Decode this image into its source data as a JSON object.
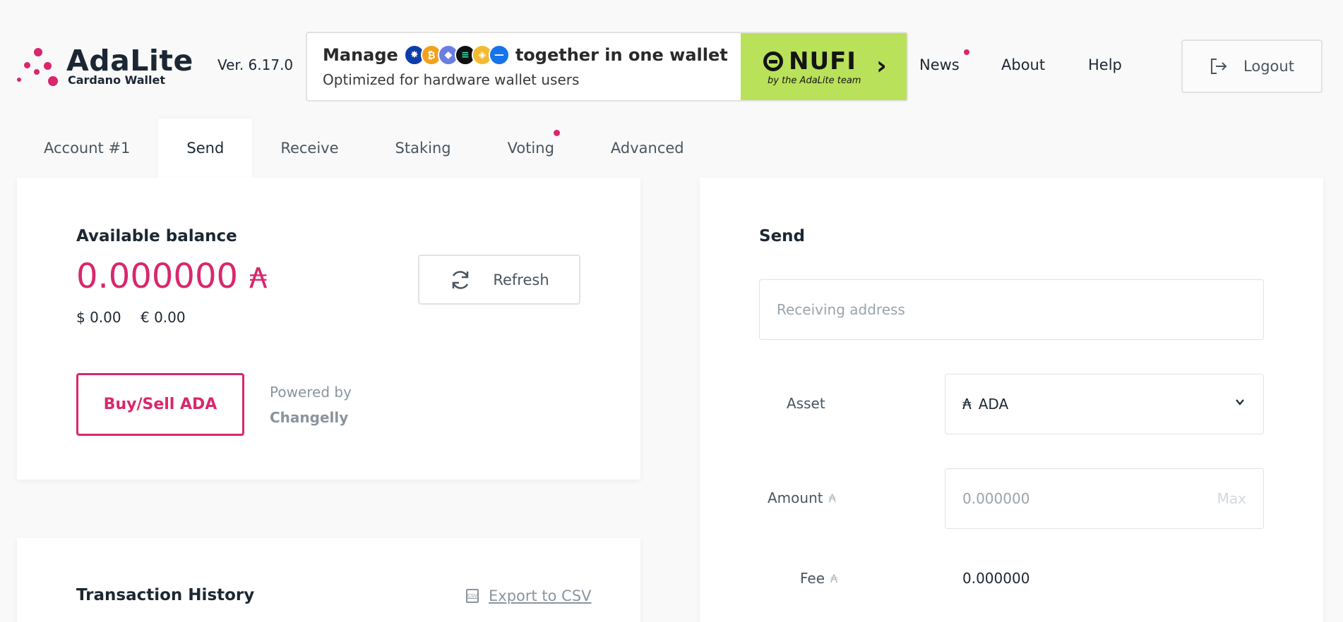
{
  "colors": {
    "accent": "#d9276c",
    "nufi_green": "#b9e15a",
    "text": "#1c2733",
    "muted": "#8a949d"
  },
  "app": {
    "name": "AdaLite",
    "subtitle": "Cardano Wallet",
    "version": "Ver. 6.17.0"
  },
  "banner": {
    "title_start": "Manage",
    "title_end": "together in one wallet",
    "subtitle": "Optimized for hardware wallet users",
    "nufi_logo": "NUFI",
    "nufi_tagline": "by the AdaLite team",
    "coin_icons": [
      "cardano-icon",
      "bitcoin-icon",
      "ethereum-icon",
      "solana-icon",
      "bnb-icon",
      "flow-icon"
    ]
  },
  "nav": {
    "news": "News",
    "about": "About",
    "help": "Help",
    "logout": "Logout"
  },
  "tabs": [
    {
      "label": "Account #1"
    },
    {
      "label": "Send"
    },
    {
      "label": "Receive"
    },
    {
      "label": "Staking"
    },
    {
      "label": "Voting"
    },
    {
      "label": "Advanced"
    }
  ],
  "balance": {
    "label": "Available balance",
    "value": "0.000000",
    "ada_symbol": "₳",
    "usd": "$ 0.00",
    "eur": "€ 0.00",
    "refresh_label": "Refresh",
    "buy_sell_label": "Buy/Sell ADA",
    "powered_by": "Powered by",
    "provider": "Changelly"
  },
  "history": {
    "title": "Transaction History",
    "export_label": "Export to CSV",
    "csv_icon_text": "CSV"
  },
  "send": {
    "title": "Send",
    "address_placeholder": "Receiving address",
    "asset_label": "Asset",
    "asset_symbol": "₳",
    "asset_value": "ADA",
    "amount_label": "Amount",
    "amount_placeholder": "0.000000",
    "max_label": "Max",
    "fee_label": "Fee",
    "fee_value": "0.000000",
    "ada_symbol": "₳"
  }
}
